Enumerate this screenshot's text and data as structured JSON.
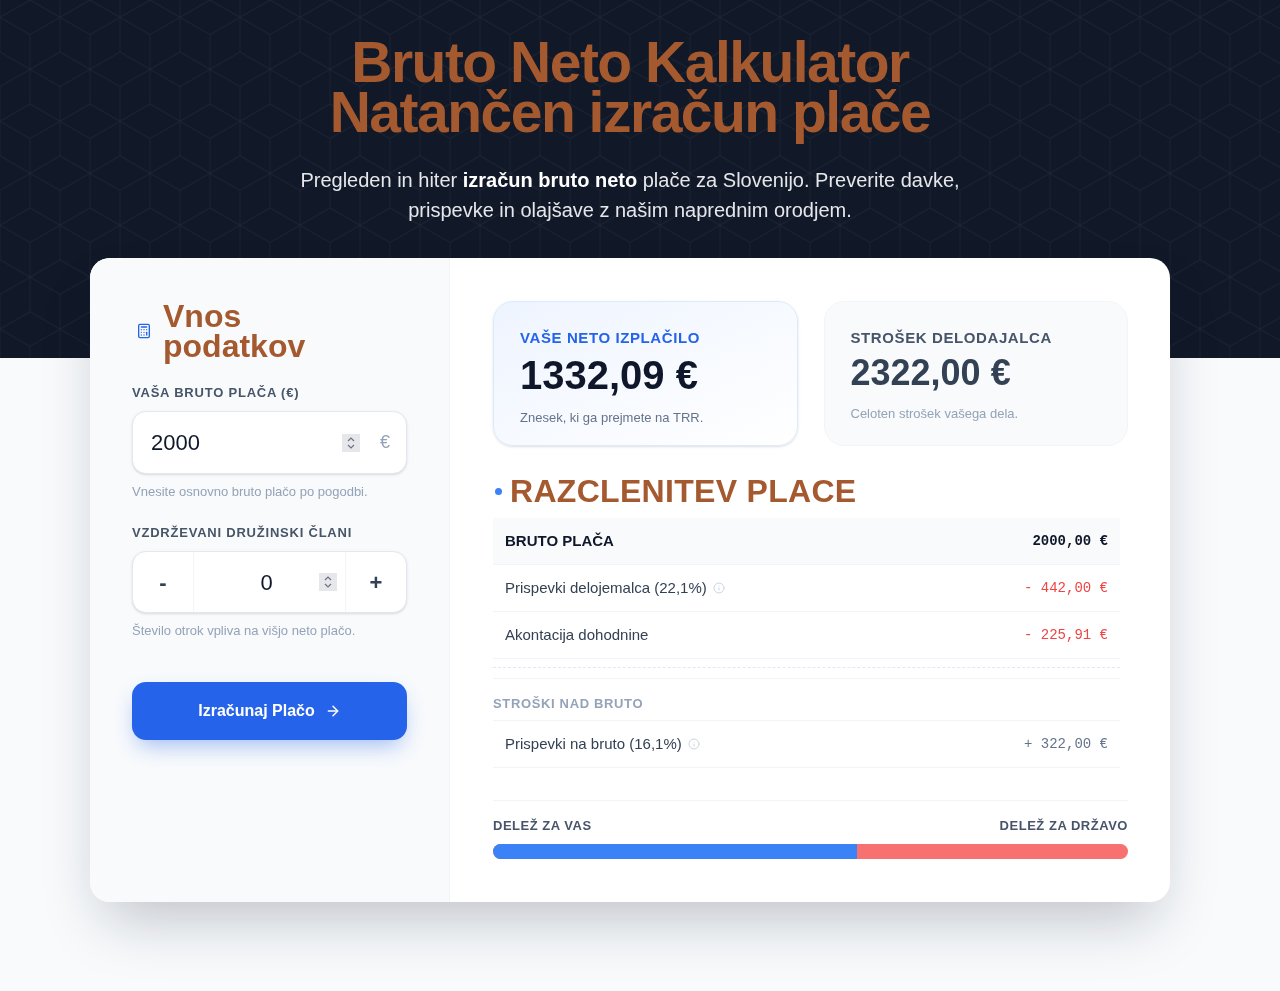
{
  "header": {
    "title": "Bruto Neto Kalkulator",
    "tagline": "Natančen izračun plače",
    "subtitle": "Pregleden in hiter **izračun bruto neto** plače za Slovenijo. Preverite davke, prispevke in olajšave z našim naprednim orodjem."
  },
  "input_panel": {
    "title": "Vnos podatkov",
    "fields": [
      {
        "kind": "currency",
        "label": "VAŠA BRUTO PLAČA (€)",
        "value": "2000",
        "suffix": "€",
        "hint": "Vnesite osnovno bruto plačo po pogodbi."
      },
      {
        "kind": "stepper",
        "label": "VZDRŽEVANI DRUŽINSKI ČLANI",
        "value": "0",
        "decrement": "-",
        "increment": "+",
        "hint": "Število otrok vpliva na višjo neto plačo."
      }
    ],
    "submit_button": "Izračunaj Plačo"
  },
  "results": {
    "summary_cards": [
      {
        "kind": "highlight",
        "label": "VAŠE NETO IZPLAČILO",
        "value": "1332,09 €",
        "caption": "Znesek, ki ga prejmete na TRR."
      },
      {
        "kind": "muted",
        "label": "STROŠEK DELODAJALCA",
        "value": "2322,00 €",
        "caption": "Celoten strošek vašega dela."
      }
    ],
    "breakdown": {
      "title": "RAZCLENITEV PLACE",
      "rows": [
        {
          "kind": "base",
          "label": "BRUTO PLAČA",
          "value": "2000,00 €",
          "info": false
        },
        {
          "kind": "deduction",
          "label": "Prispevki delojemalca (22,1%)",
          "value": "- 442,00 €",
          "info": true
        },
        {
          "kind": "deduction",
          "label": "Akontacija dohodnine",
          "value": "- 225,91 €",
          "info": false
        }
      ]
    },
    "extra_costs": {
      "title": "STROŠKI NAD BRUTO",
      "rows": [
        {
          "kind": "addition",
          "label": "Prispevki na bruto (16,1%)",
          "value": "+ 322,00 €",
          "info": true
        }
      ]
    },
    "share": {
      "left_label": "DELEŽ ZA VAS",
      "right_label": "DELEŽ ZA DRŽAVO",
      "level": 0.574
    }
  }
}
